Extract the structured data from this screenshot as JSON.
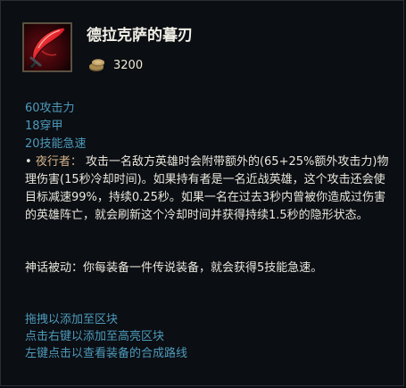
{
  "item": {
    "name": "德拉克萨的暮刃",
    "icon": "draktharr-duskblade-icon",
    "cost": "3200",
    "cost_icon": "gold-coins-icon"
  },
  "stats": [
    "60攻击力",
    "18穿甲",
    "20技能急速"
  ],
  "passive": {
    "bullet": "•",
    "name": "夜行者：",
    "text": "攻击一名敌方英雄时会附带额外的(65+25%额外攻击力)物理伤害(15秒冷却时间)。如果持有者是一名近战英雄，这个攻击还会使目标减速99%，持续0.25秒。如果一名在过去3秒内曾被你造成过伤害的英雄阵亡，就会刷新这个冷却时间并获得持续1.5秒的隐形状态。"
  },
  "mythic": "神话被动：你每装备一件传说装备，就会获得5技能急速。",
  "hints": [
    "拖拽以添加至区块",
    "点击右键以添加至高亮区块",
    "左键点击以查看装备的合成路线"
  ],
  "colors": {
    "stat_blue": "#4d9bbb",
    "passive_name": "#d4b38a",
    "body_text": "#e9e6dc",
    "background": "#0b0e13"
  }
}
